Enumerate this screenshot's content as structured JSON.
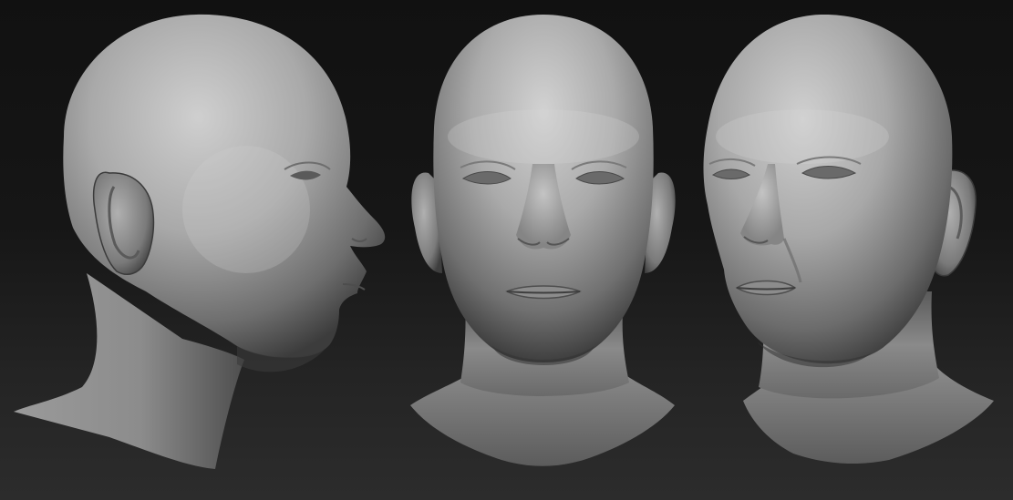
{
  "scene": {
    "views": [
      {
        "view": "profile",
        "facing": "right"
      },
      {
        "view": "front",
        "facing": "forward"
      },
      {
        "view": "three-quarter",
        "facing": "left"
      }
    ],
    "colors": {
      "background_top": "#111111",
      "background_bottom": "#2c2c2c",
      "clay_light": "#c9c9c9",
      "clay_mid": "#9a9a9a",
      "clay_dark": "#4a4a4a"
    }
  }
}
